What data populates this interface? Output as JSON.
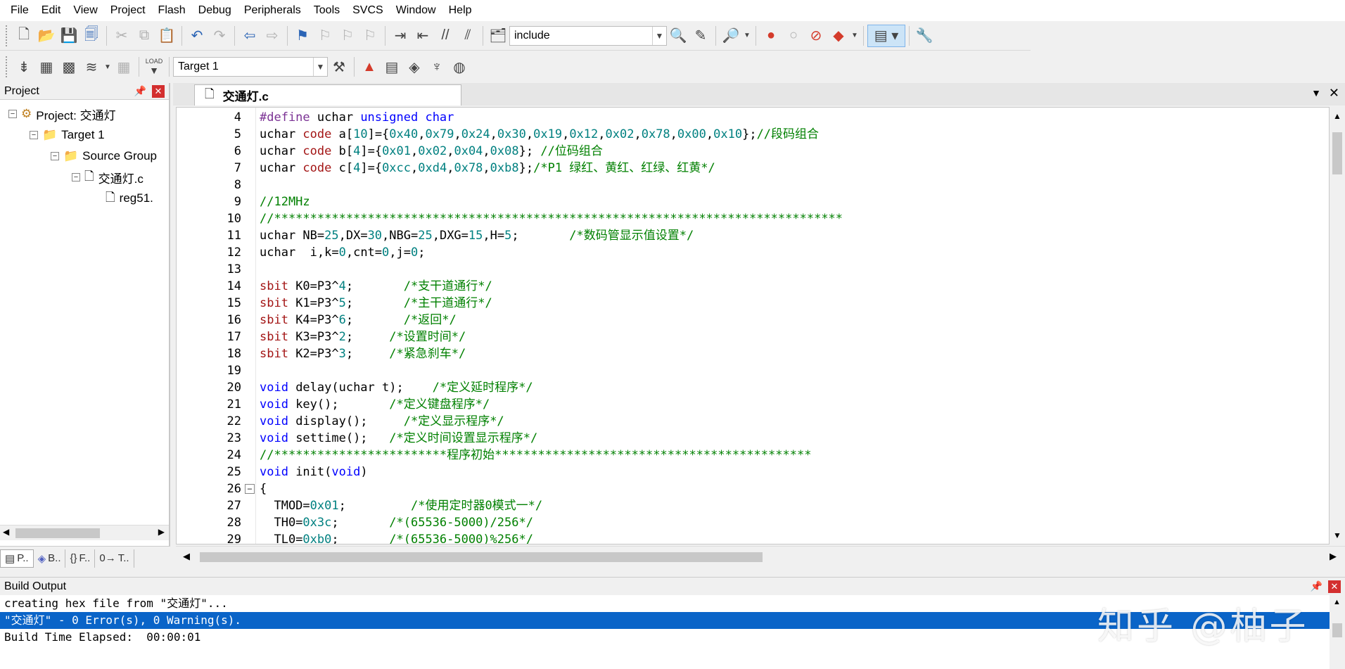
{
  "menu": [
    "File",
    "Edit",
    "View",
    "Project",
    "Flash",
    "Debug",
    "Peripherals",
    "Tools",
    "SVCS",
    "Window",
    "Help"
  ],
  "toolbar": {
    "find_value": "include",
    "target_value": "Target 1",
    "load_label": "LOAD"
  },
  "project_panel": {
    "title": "Project",
    "tree": {
      "project": "Project: 交通灯",
      "target": "Target 1",
      "group": "Source Group",
      "file1": "交通灯.c",
      "file2": "reg51."
    },
    "tabs": [
      "P..",
      "B..",
      "F..",
      "T.."
    ]
  },
  "editor": {
    "tab_label": "交通灯.c",
    "lines": [
      {
        "n": "4",
        "code": "#define uchar unsigned char"
      },
      {
        "n": "5",
        "code": "uchar code a[10]={0x40,0x79,0x24,0x30,0x19,0x12,0x02,0x78,0x00,0x10};//段码组合"
      },
      {
        "n": "6",
        "code": "uchar code b[4]={0x01,0x02,0x04,0x08}; //位码组合"
      },
      {
        "n": "7",
        "code": "uchar code c[4]={0xcc,0xd4,0x78,0xb8};/*P1 绿红、黄红、红绿、红黄*/"
      },
      {
        "n": "8",
        "code": ""
      },
      {
        "n": "9",
        "code": "//12MHz"
      },
      {
        "n": "10",
        "code": "//*******************************************************************************"
      },
      {
        "n": "11",
        "code": "uchar NB=25,DX=30,NBG=25,DXG=15,H=5;       /*数码管显示值设置*/"
      },
      {
        "n": "12",
        "code": "uchar  i,k=0,cnt=0,j=0;"
      },
      {
        "n": "13",
        "code": ""
      },
      {
        "n": "14",
        "code": "sbit K0=P3^4;       /*支干道通行*/"
      },
      {
        "n": "15",
        "code": "sbit K1=P3^5;       /*主干道通行*/"
      },
      {
        "n": "16",
        "code": "sbit K4=P3^6;       /*返回*/"
      },
      {
        "n": "17",
        "code": "sbit K3=P3^2;     /*设置时间*/"
      },
      {
        "n": "18",
        "code": "sbit K2=P3^3;     /*紧急刹车*/"
      },
      {
        "n": "19",
        "code": ""
      },
      {
        "n": "20",
        "code": "void delay(uchar t);    /*定义延时程序*/"
      },
      {
        "n": "21",
        "code": "void key();       /*定义键盘程序*/"
      },
      {
        "n": "22",
        "code": "void display();     /*定义显示程序*/"
      },
      {
        "n": "23",
        "code": "void settime();   /*定义时间设置显示程序*/"
      },
      {
        "n": "24",
        "code": "//************************程序初始********************************************"
      },
      {
        "n": "25",
        "code": "void init(void)"
      },
      {
        "n": "26",
        "code": "{"
      },
      {
        "n": "27",
        "code": "  TMOD=0x01;         /*使用定时器0模式一*/"
      },
      {
        "n": "28",
        "code": "  TH0=0x3c;       /*(65536-5000)/256*/"
      },
      {
        "n": "29",
        "code": "  TL0=0xb0;       /*(65536-5000)%256*/"
      }
    ]
  },
  "output": {
    "title": "Build Output",
    "lines": [
      "creating hex file from \"交通灯\"...",
      "\"交通灯\" - 0 Error(s), 0 Warning(s).",
      "Build Time Elapsed:  00:00:01"
    ],
    "watermark": "知乎 @柚子"
  }
}
